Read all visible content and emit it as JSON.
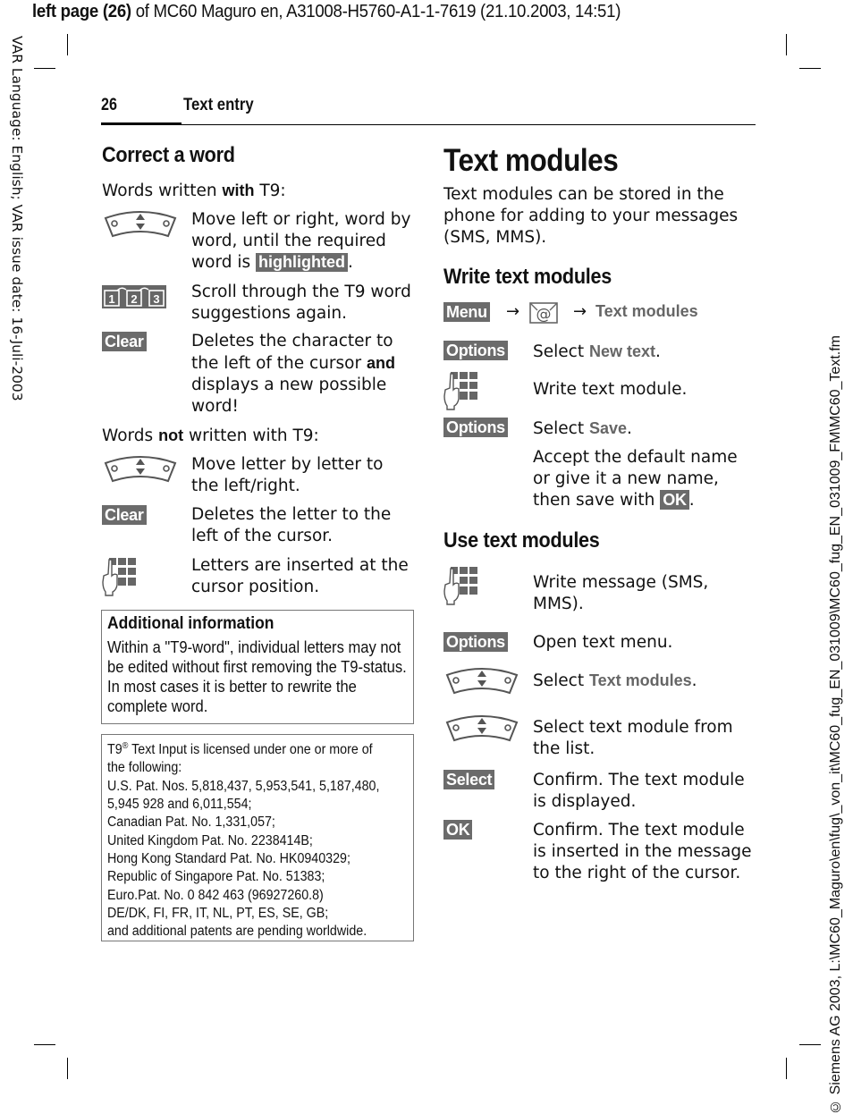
{
  "file_header": {
    "bold_part": "left page (26)",
    "rest": " of MC60 Maguro en, A31008-H5760-A1-1-7619 (21.10.2003, 14:51)"
  },
  "side_left": "VAR Language: English; VAR issue date: 16-Juli-2003",
  "side_right": "© Siemens AG 2003, L:\\MC60_Maguro\\en\\fug\\_von_it\\MC60_fug_EN_031009\\MC60_fug_EN_031009_FM\\MC60_Text.fm",
  "running_head": {
    "page_number": "26",
    "chapter": "Text entry"
  },
  "left": {
    "heading": "Correct a word",
    "t9_intro": {
      "pre": "Words written ",
      "bold": "with",
      "post": " T9:"
    },
    "t9_rows": [
      {
        "icon": "navigation-key-icon",
        "text_pre": "Move left or right, word by word, until the required word is ",
        "highlight": "highlighted",
        "text_post": "."
      },
      {
        "icon": "keys-1-2-3-icon",
        "text": "Scroll through the T9 word suggestions again."
      },
      {
        "icon": "clear-softkey",
        "badge": "Clear",
        "text_pre": "Deletes the character to the left of the cursor ",
        "bold": "and",
        "text_post": " displays a new possible word!"
      }
    ],
    "non_t9_intro": {
      "pre": "Words ",
      "bold": "not",
      "post": " written with T9:"
    },
    "non_t9_rows": [
      {
        "icon": "navigation-key-icon",
        "text": "Move letter by letter to the left/right."
      },
      {
        "icon": "clear-softkey",
        "badge": "Clear",
        "text": "Deletes the letter to the left of the cursor."
      },
      {
        "icon": "keypad-hand-icon",
        "text": "Letters are inserted at the cursor position."
      }
    ],
    "info_box": {
      "title": "Additional information",
      "text": "Within a \"T9-word\", individual letters may not be edited without first removing the T9-status. In most cases it is better to rewrite the complete word."
    },
    "patent_box": {
      "lines": [
        "T9® Text Input is licensed under one or more of",
        "the following:",
        "U.S. Pat. Nos. 5,818,437, 5,953,541, 5,187,480,",
        "5,945 928 and 6,011,554;",
        "Canadian Pat. No. 1,331,057;",
        "United Kingdom Pat. No. 2238414B;",
        "Hong Kong Standard Pat. No. HK0940329;",
        "Republic of Singapore Pat. No. 51383;",
        "Euro.Pat. No. 0 842 463 (96927260.8)",
        "DE/DK, FI, FR, IT, NL, PT, ES, SE, GB;",
        "and additional patents are pending worldwide."
      ]
    }
  },
  "right": {
    "title": "Text modules",
    "intro": "Text modules can be stored in the phone for adding to your messages (SMS, MMS).",
    "write": {
      "heading": "Write text modules",
      "path": {
        "menu": "Menu",
        "arrow": "→",
        "icon": "message-envelope-icon",
        "target": "Text modules"
      },
      "rows": [
        {
          "badge": "Options",
          "pre": "Select ",
          "ref": "New text",
          "post": "."
        },
        {
          "icon": "keypad-hand-icon",
          "text": "Write text module."
        },
        {
          "badge": "Options",
          "pre": "Select ",
          "ref": "Save",
          "post": "."
        },
        {
          "pre": "Accept the default name or give it a new name, then save with ",
          "badge": "OK",
          "post": "."
        }
      ]
    },
    "use": {
      "heading": "Use text modules",
      "rows": [
        {
          "icon": "keypad-hand-icon",
          "text": "Write message (SMS, MMS)."
        },
        {
          "badge": "Options",
          "text": "Open text menu."
        },
        {
          "icon": "navigation-key-icon",
          "pre": "Select ",
          "ref": "Text modules",
          "post": "."
        },
        {
          "icon": "navigation-key-icon",
          "text": "Select text module from the list."
        },
        {
          "badge": "Select",
          "text": "Confirm. The text module is displayed."
        },
        {
          "badge": "OK",
          "text": "Confirm. The text module is inserted in the message to the right of the cursor."
        }
      ]
    }
  },
  "colors": {
    "badge_bg": "#6b6b6b",
    "badge_text": "#ffffff",
    "menu_ref": "#666666",
    "box_border": "#777777"
  }
}
